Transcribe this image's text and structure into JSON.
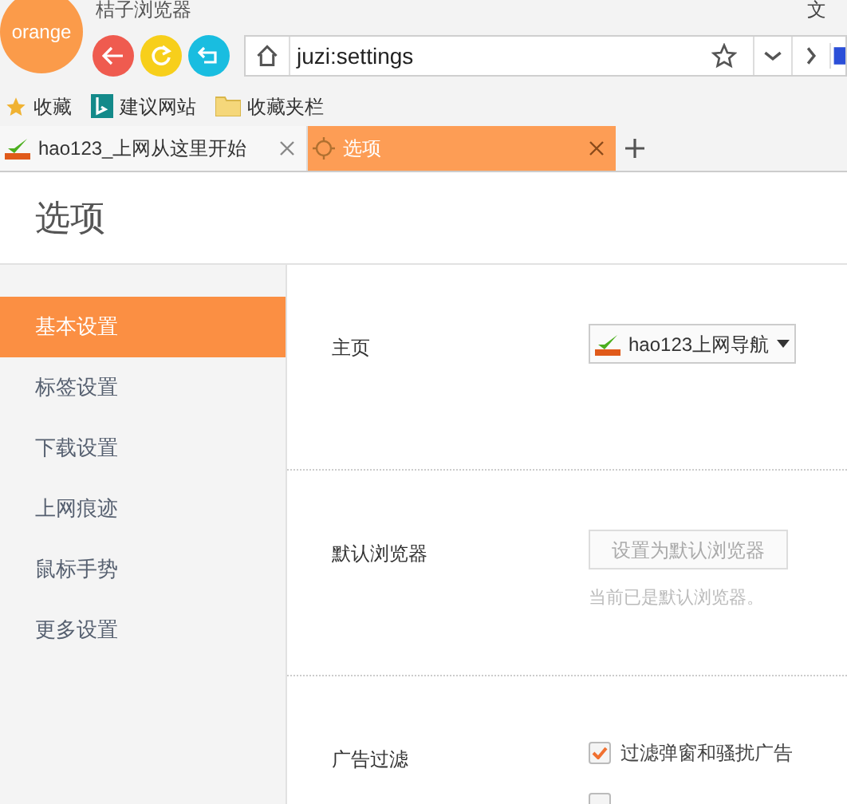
{
  "window": {
    "title": "桔子浏览器",
    "logo": "orange",
    "menu": "文"
  },
  "address_bar": {
    "value": "juzi:settings"
  },
  "bookmarks": [
    {
      "label": "收藏",
      "kind": "star"
    },
    {
      "label": "建议网站",
      "kind": "bing"
    },
    {
      "label": "收藏夹栏",
      "kind": "folder"
    }
  ],
  "tabs": [
    {
      "label": "hao123_上网从这里开始",
      "selected": false,
      "kind": "hao"
    },
    {
      "label": "选项",
      "selected": true,
      "kind": "gear"
    }
  ],
  "page": {
    "title": "选项"
  },
  "sidebar": {
    "items": [
      {
        "label": "基本设置",
        "selected": true
      },
      {
        "label": "标签设置",
        "selected": false
      },
      {
        "label": "下载设置",
        "selected": false
      },
      {
        "label": "上网痕迹",
        "selected": false
      },
      {
        "label": "鼠标手势",
        "selected": false
      },
      {
        "label": "更多设置",
        "selected": false
      }
    ]
  },
  "sections": [
    {
      "label": "主页",
      "kind": "dropdown",
      "value": "hao123上网导航"
    },
    {
      "label": "默认浏览器",
      "kind": "button",
      "button": "设置为默认浏览器",
      "note": "当前已是默认浏览器。"
    },
    {
      "label": "广告过滤",
      "kind": "checkboxes",
      "options": [
        {
          "label": "过滤弹窗和骚扰广告",
          "checked": true
        },
        {
          "checked": false
        }
      ]
    }
  ]
}
